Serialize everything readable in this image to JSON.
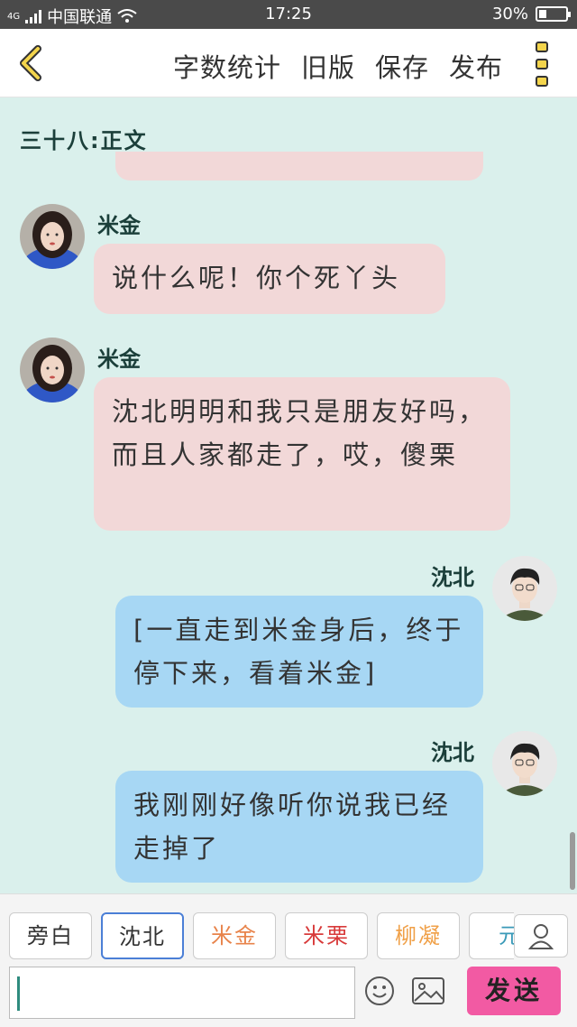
{
  "status_bar": {
    "network": "4G",
    "carrier": "中国联通",
    "time": "17:25",
    "battery": "30%",
    "battery_level": 0.3
  },
  "header": {
    "back_icon": "chevron-left-icon",
    "actions": [
      "字数统计",
      "旧版",
      "保存",
      "发布"
    ],
    "more_icon": "more-vertical-icon"
  },
  "chapter_title": "三十八:正文",
  "messages": [
    {
      "side": "left",
      "sender": "米金",
      "text": "说什么呢！你个死丫头"
    },
    {
      "side": "left",
      "sender": "米金",
      "text": "沈北明明和我只是朋友好吗，而且人家都走了，哎，傻栗"
    },
    {
      "side": "right",
      "sender": "沈北",
      "text": "[一直走到米金身后，终于停下来，看着米金]"
    },
    {
      "side": "right",
      "sender": "沈北",
      "text": "我刚刚好像听你说我已经走掉了"
    }
  ],
  "role_tabs": [
    {
      "label": "旁白",
      "color": "#333333"
    },
    {
      "label": "沈北",
      "color": "#333333"
    },
    {
      "label": "米金",
      "color": "#e8834a"
    },
    {
      "label": "米栗",
      "color": "#d83a3a"
    },
    {
      "label": "柳凝",
      "color": "#f0a048"
    },
    {
      "label": "元",
      "color": "#3a9ab8"
    }
  ],
  "active_role": "沈北",
  "input": {
    "value": ""
  },
  "send_label": "发送",
  "colors": {
    "background": "#daf0ec",
    "left_bubble": "#f2d8d8",
    "right_bubble": "#a7d7f4",
    "send": "#f25aa3",
    "name": "#1b3f3a"
  }
}
